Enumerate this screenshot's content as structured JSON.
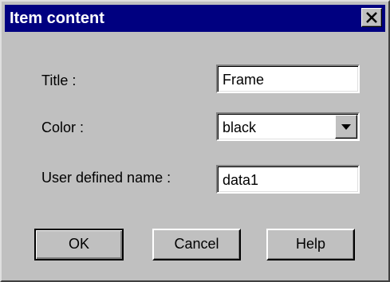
{
  "window": {
    "title": "Item content",
    "close_icon": "close-icon"
  },
  "form": {
    "title_label": "Title :",
    "title_value": "Frame",
    "color_label": "Color :",
    "color_value": "black",
    "color_dropdown_icon": "chevron-down-icon",
    "user_name_label": "User defined name :",
    "user_name_value": "data1"
  },
  "buttons": {
    "ok": "OK",
    "cancel": "Cancel",
    "help": "Help"
  },
  "colors": {
    "title_bar": "#000080",
    "face": "#c0c0c0"
  }
}
